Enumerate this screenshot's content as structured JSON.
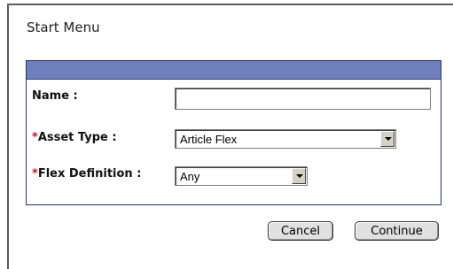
{
  "title": "Start Menu",
  "form": {
    "name": {
      "label": "Name :",
      "value": "",
      "placeholder": ""
    },
    "asset_type": {
      "required_mark": "*",
      "label": "Asset Type :",
      "selected": "Article Flex"
    },
    "flex_definition": {
      "required_mark": "*",
      "label": "Flex Definition :",
      "selected": "Any"
    }
  },
  "buttons": {
    "cancel": "Cancel",
    "continue": "Continue"
  },
  "colors": {
    "panel_header": "#6e7fbb",
    "panel_border": "#23347a",
    "required": "#c8102e"
  },
  "icons": {
    "dropdown": "chevron-down-icon"
  }
}
